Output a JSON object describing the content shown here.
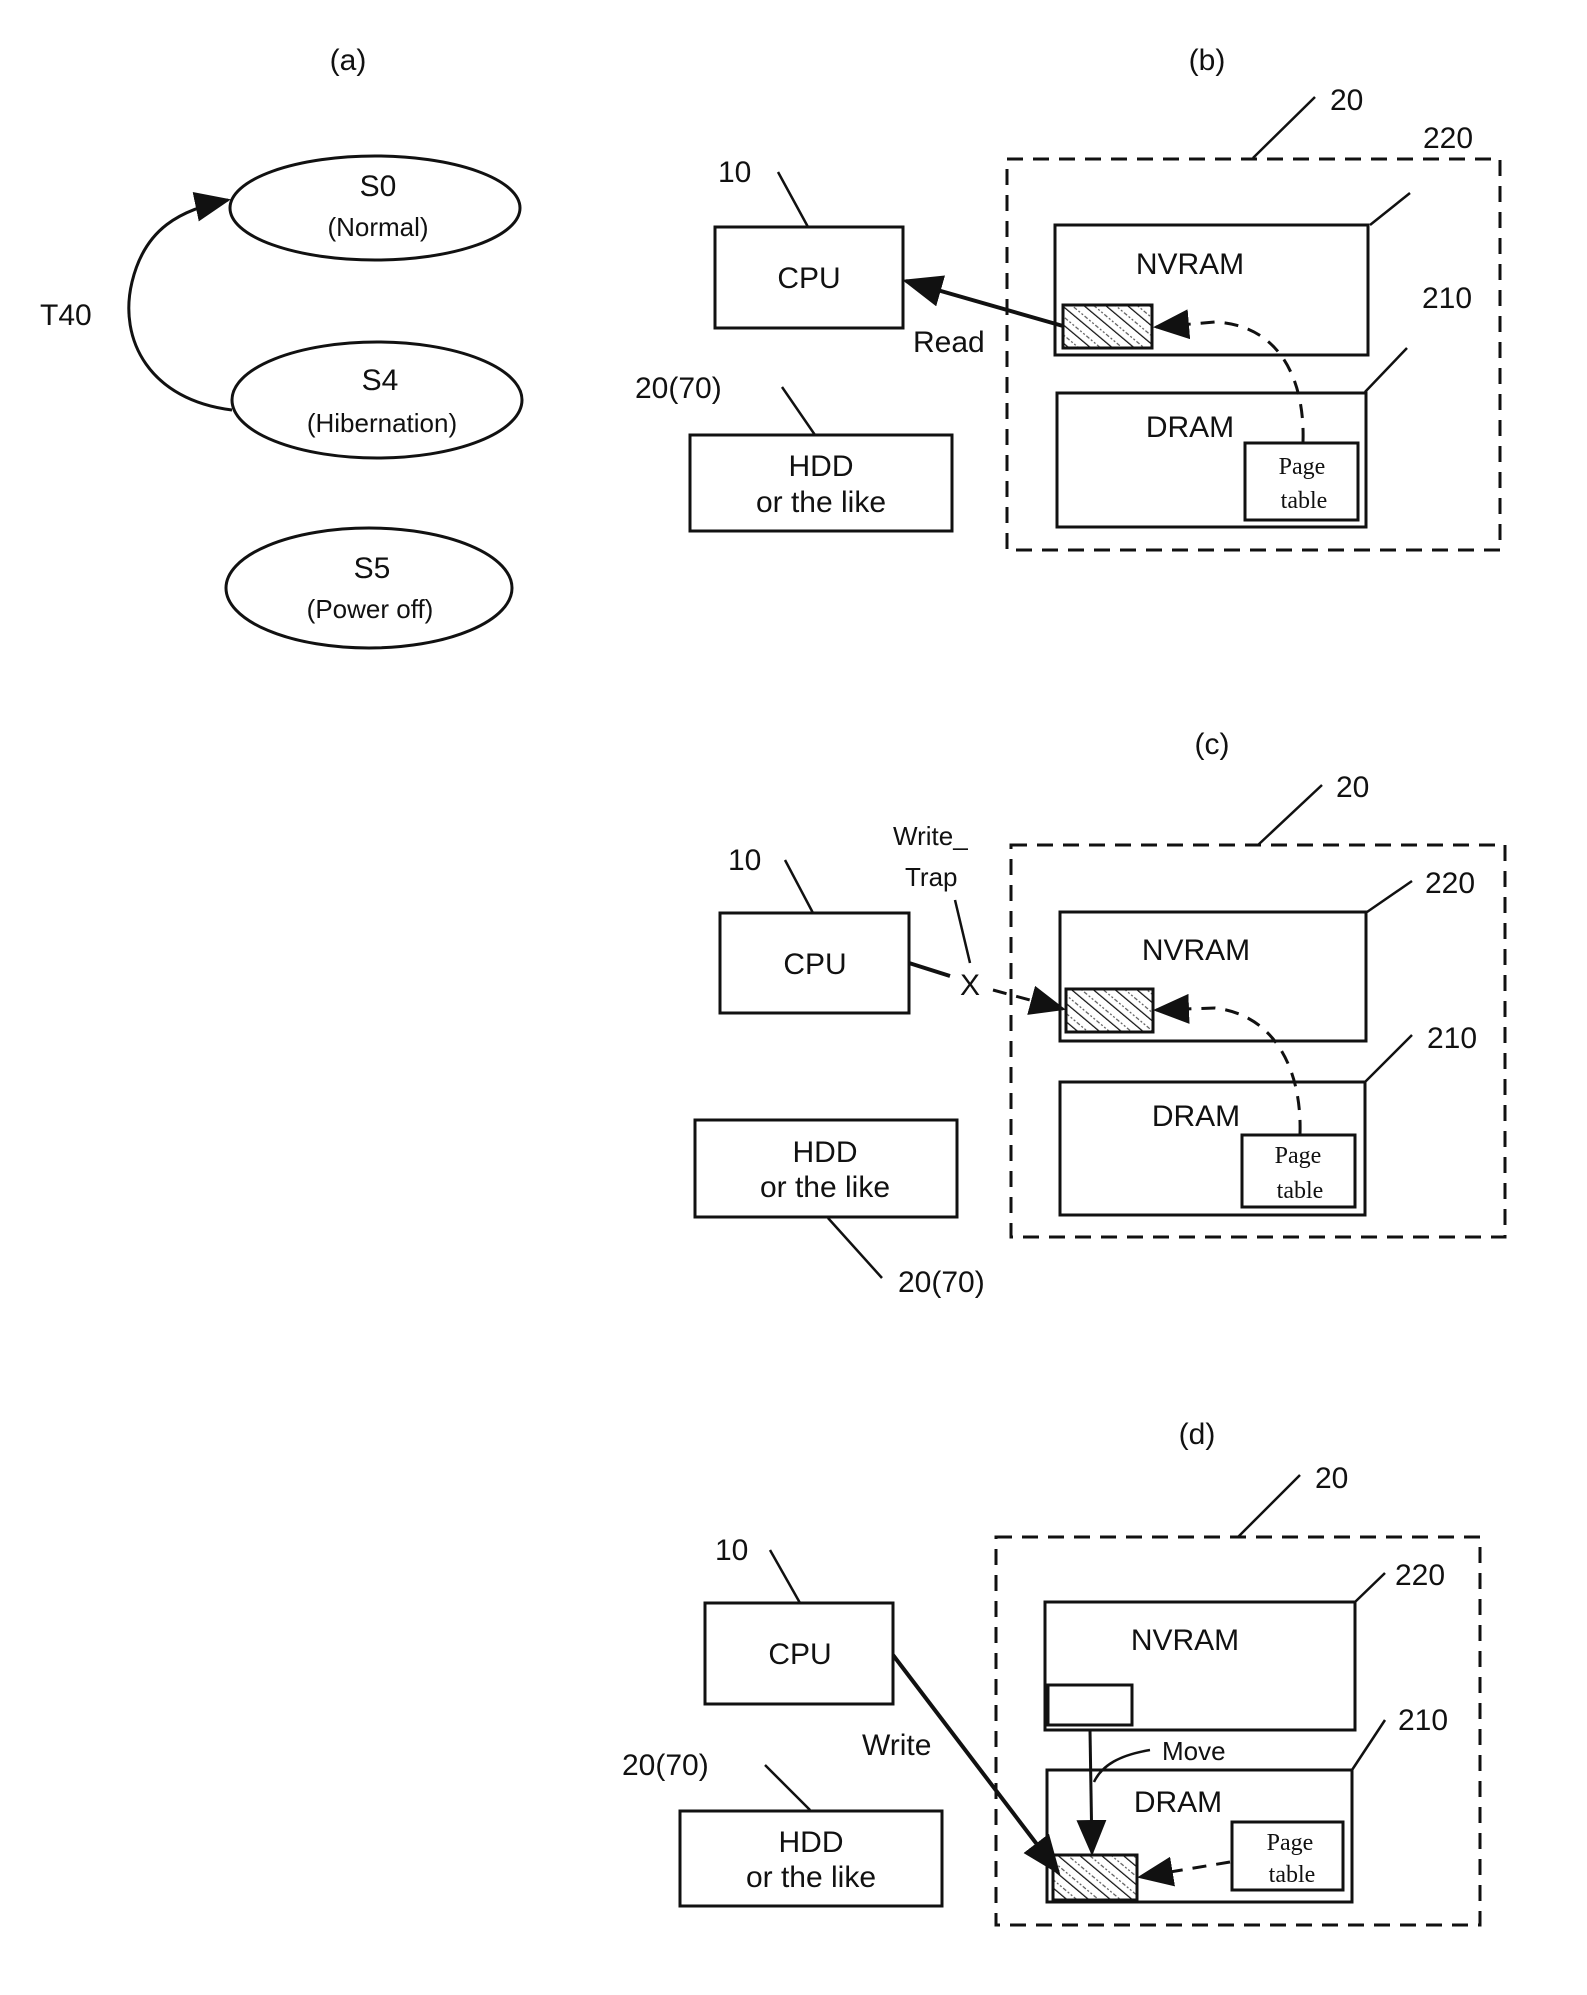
{
  "figure": {
    "panels": {
      "a": {
        "heading": "(a)",
        "states": [
          {
            "id": "S0",
            "name": "S0",
            "desc": "(Normal)"
          },
          {
            "id": "S4",
            "name": "S4",
            "desc": "(Hibernation)"
          },
          {
            "id": "S5",
            "name": "S5",
            "desc": "(Power off)"
          }
        ],
        "transition": {
          "label": "T40",
          "from": "S4",
          "to": "S0"
        }
      },
      "b": {
        "heading": "(b)",
        "cpu": {
          "label": "CPU",
          "ref": "10"
        },
        "storage": {
          "line1": "HDD",
          "line2": "or the like",
          "ref": "20(70)"
        },
        "memory": {
          "ref": "20"
        },
        "nvram": {
          "label": "NVRAM",
          "ref": "220"
        },
        "dram": {
          "label": "DRAM",
          "ref": "210"
        },
        "page_table": {
          "line1": "Page",
          "line2": "table"
        },
        "access_label": "Read"
      },
      "c": {
        "heading": "(c)",
        "cpu": {
          "label": "CPU",
          "ref": "10"
        },
        "storage": {
          "line1": "HDD",
          "line2": "or the like",
          "ref": "20(70)"
        },
        "memory": {
          "ref": "20"
        },
        "nvram": {
          "label": "NVRAM",
          "ref": "220"
        },
        "dram": {
          "label": "DRAM",
          "ref": "210"
        },
        "page_table": {
          "line1": "Page",
          "line2": "table"
        },
        "trap_label_line1": "Write_",
        "trap_label_line2": "Trap",
        "blocked_mark": "X"
      },
      "d": {
        "heading": "(d)",
        "cpu": {
          "label": "CPU",
          "ref": "10"
        },
        "storage": {
          "line1": "HDD",
          "line2": "or the like",
          "ref": "20(70)"
        },
        "memory": {
          "ref": "20"
        },
        "nvram": {
          "label": "NVRAM",
          "ref": "220"
        },
        "dram": {
          "label": "DRAM",
          "ref": "210"
        },
        "page_table": {
          "line1": "Page",
          "line2": "table"
        },
        "access_label": "Write",
        "move_label": "Move"
      }
    }
  }
}
